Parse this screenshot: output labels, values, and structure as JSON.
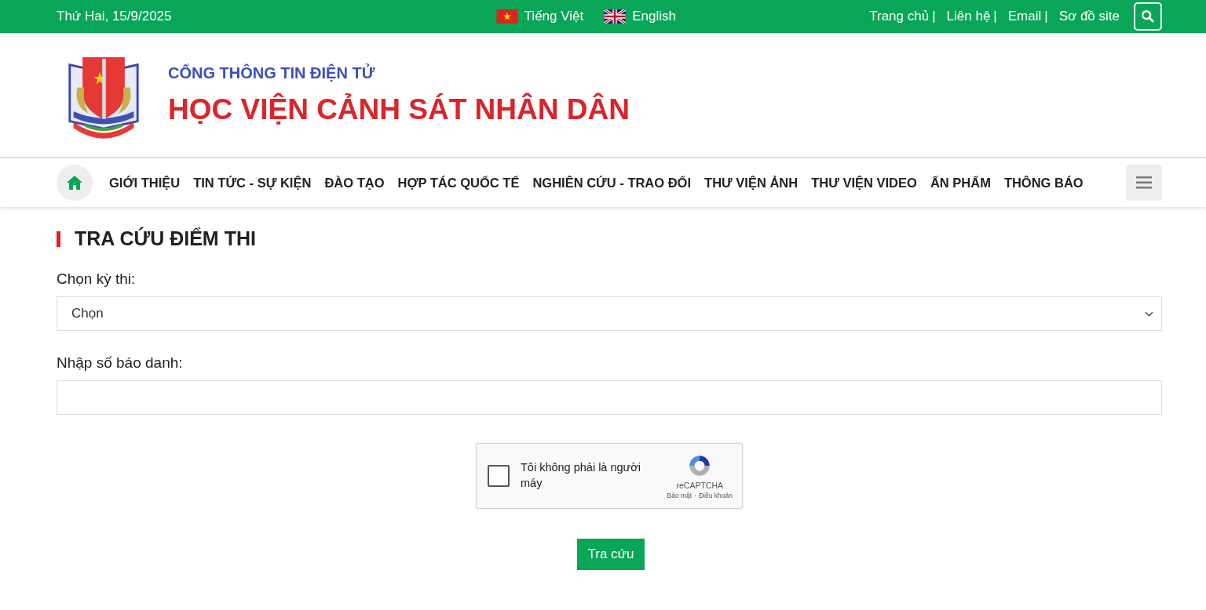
{
  "top_bar": {
    "date": "Thứ Hai, 15/9/2025",
    "languages": [
      {
        "label": "Tiếng Việt",
        "kind": "vn"
      },
      {
        "label": "English",
        "kind": "uk"
      }
    ],
    "links": [
      "Trang chủ",
      "Liên hệ",
      "Email",
      "Sơ đồ site"
    ],
    "separator": "|"
  },
  "header": {
    "subtitle": "CỔNG THÔNG TIN ĐIỆN TỬ",
    "title": "HỌC VIỆN CẢNH SÁT NHÂN DÂN"
  },
  "nav": {
    "items": [
      "GIỚI THIỆU",
      "TIN TỨC - SỰ KIỆN",
      "ĐÀO TẠO",
      "HỢP TÁC QUỐC TẾ",
      "NGHIÊN CỨU - TRAO ĐỔI",
      "THƯ VIỆN ẢNH",
      "THƯ VIỆN VIDEO",
      "ẤN PHẨM",
      "THÔNG BÁO"
    ]
  },
  "form": {
    "heading": "TRA CỨU ĐIỂM THI",
    "exam_label": "Chọn kỳ thi:",
    "exam_select": {
      "value": "Chọn"
    },
    "id_label": "Nhập số báo danh:",
    "captcha": {
      "checked": false,
      "text": "Tôi không phải là người máy",
      "brand": "reCAPTCHA",
      "privacy": "Bảo mật",
      "sep": "-",
      "terms": "Điều khoản"
    },
    "submit": "Tra cứu"
  }
}
